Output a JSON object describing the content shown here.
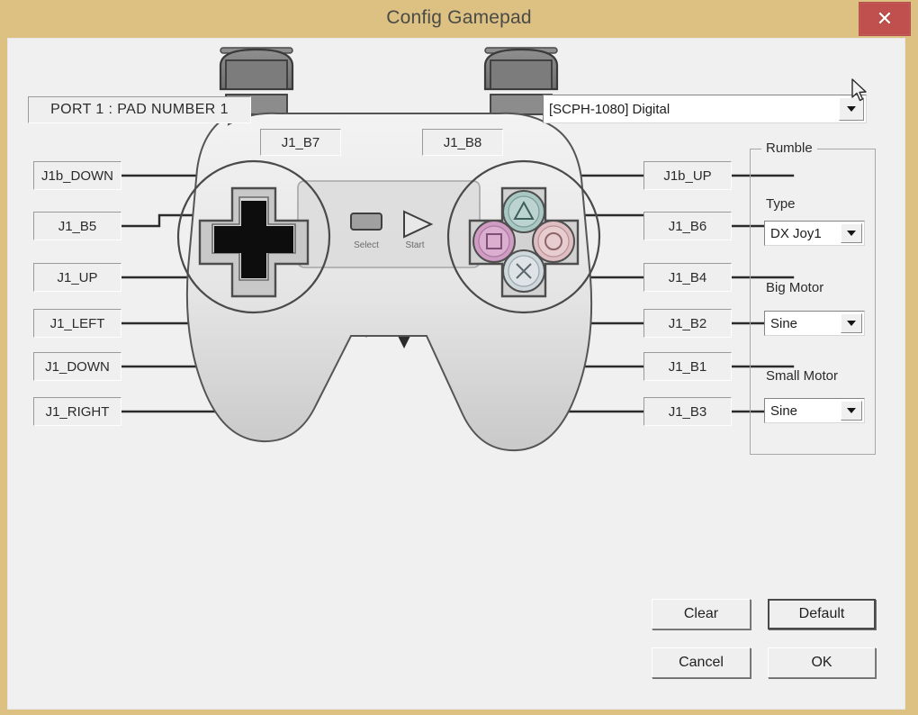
{
  "window": {
    "title": "Config Gamepad",
    "close_label": "✕"
  },
  "header": {
    "port_label": "PORT 1 : PAD NUMBER 1",
    "pad_type_value": "[SCPH-1080] Digital"
  },
  "bindings": {
    "left": [
      {
        "label": "J1b_DOWN"
      },
      {
        "label": "J1_B5"
      },
      {
        "label": "J1_UP"
      },
      {
        "label": "J1_LEFT"
      },
      {
        "label": "J1_DOWN"
      },
      {
        "label": "J1_RIGHT"
      }
    ],
    "top": [
      {
        "label": "J1_B7"
      },
      {
        "label": "J1_B8"
      }
    ],
    "right": [
      {
        "label": "J1b_UP"
      },
      {
        "label": "J1_B6"
      },
      {
        "label": "J1_B4"
      },
      {
        "label": "J1_B2"
      },
      {
        "label": "J1_B1"
      },
      {
        "label": "J1_B3"
      }
    ]
  },
  "pad_diagram": {
    "shoulder_left_top": "2",
    "shoulder_left_bottom": "1",
    "shoulder_right_top": "2",
    "shoulder_right_bottom": "1",
    "select_label": "Select",
    "start_label": "Start",
    "face_buttons": {
      "triangle_color": "#a9c8c4",
      "square_color": "#d09cc4",
      "circle_color": "#debec2",
      "cross_color": "#cfd8dc"
    }
  },
  "rumble": {
    "group_title": "Rumble",
    "type_label": "Type",
    "type_value": "DX Joy1",
    "big_motor_label": "Big Motor",
    "big_motor_value": "Sine",
    "small_motor_label": "Small Motor",
    "small_motor_value": "Sine"
  },
  "buttons": {
    "clear": "Clear",
    "default": "Default",
    "cancel": "Cancel",
    "ok": "OK"
  },
  "colors": {
    "titlebar": "#ddc182",
    "close": "#c0504d",
    "client": "#f0f0f0"
  }
}
